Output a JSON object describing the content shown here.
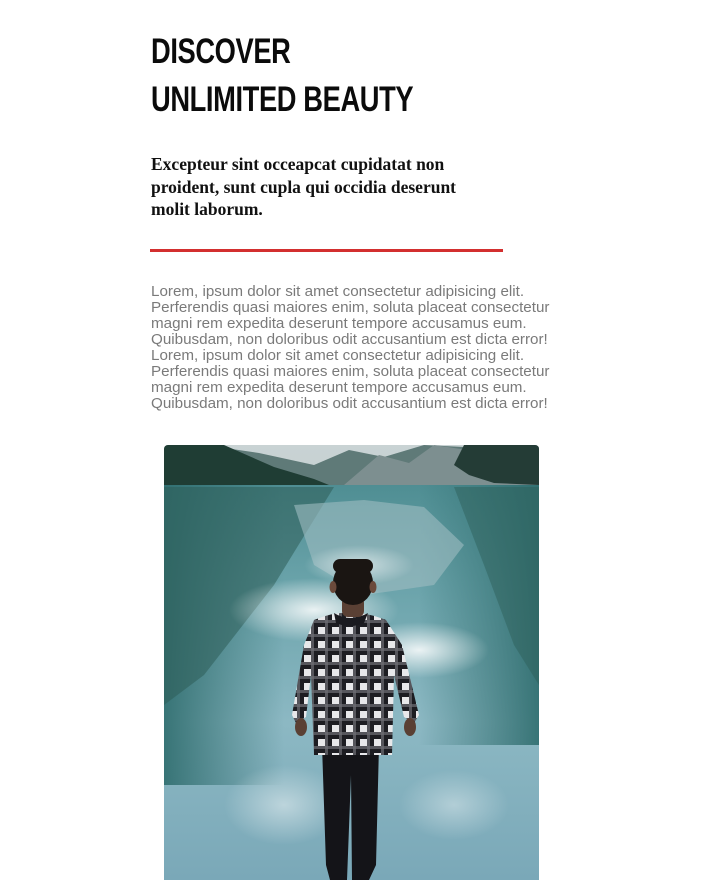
{
  "headline": {
    "line1": "DISCOVER",
    "line2": "UNLIMITED BEAUTY"
  },
  "lead": "Excepteur sint occeapcat cupidatat non proident, sunt cupla qui occidia deserunt molit laborum.",
  "accent_color": "#d32f2f",
  "body_text": "Lorem, ipsum dolor sit amet consectetur adipisicing elit. Perferendis quasi maiores enim, soluta placeat consectetur magni rem expedita deserunt tempore accusamus eum. Quibusdam, non doloribus odit accusantium est dicta error! Lorem, ipsum dolor sit amet consectetur adipisicing elit. Perferendis quasi maiores enim, soluta placeat consectetur magni rem expedita deserunt tempore accusamus eum. Quibusdam, non doloribus odit accusantium est dicta error!",
  "photo": {
    "subject": "man-by-mountain-lake"
  }
}
